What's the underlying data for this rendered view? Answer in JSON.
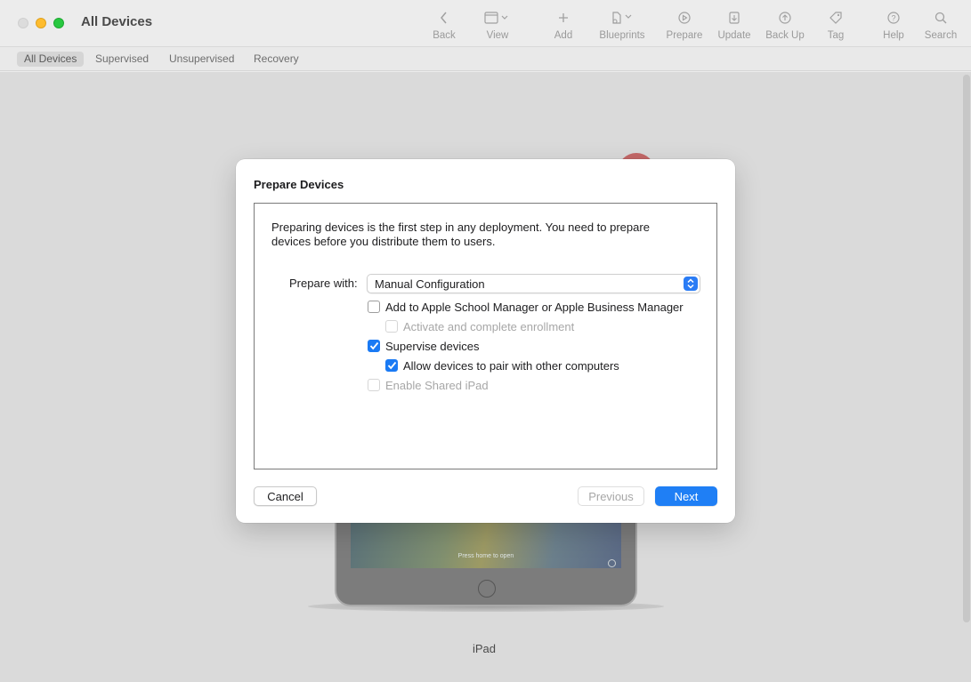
{
  "window": {
    "title": "All Devices"
  },
  "toolbar": {
    "back": "Back",
    "view": "View",
    "add": "Add",
    "blueprints": "Blueprints",
    "prepare": "Prepare",
    "update": "Update",
    "back_up": "Back Up",
    "tag": "Tag",
    "help": "Help",
    "search": "Search"
  },
  "filters": [
    "All Devices",
    "Supervised",
    "Unsupervised",
    "Recovery"
  ],
  "device": {
    "name": "iPad",
    "lock_text": "Press home to open"
  },
  "dialog": {
    "title": "Prepare Devices",
    "intro": "Preparing devices is the first step in any deployment. You need to prepare devices before you distribute them to users.",
    "prepare_with_label": "Prepare with:",
    "prepare_with_value": "Manual Configuration",
    "options": {
      "add_to_manager": {
        "label": "Add to Apple School Manager or Apple Business Manager",
        "checked": false,
        "enabled": true
      },
      "activate_enrollment": {
        "label": "Activate and complete enrollment",
        "checked": false,
        "enabled": false
      },
      "supervise": {
        "label": "Supervise devices",
        "checked": true,
        "enabled": true
      },
      "allow_pair": {
        "label": "Allow devices to pair with other computers",
        "checked": true,
        "enabled": true
      },
      "shared_ipad": {
        "label": "Enable Shared iPad",
        "checked": false,
        "enabled": false
      }
    },
    "buttons": {
      "cancel": "Cancel",
      "previous": "Previous",
      "next": "Next"
    }
  },
  "colors": {
    "accent": "#1f7ff5",
    "disabled_text": "#a7a7a7"
  }
}
